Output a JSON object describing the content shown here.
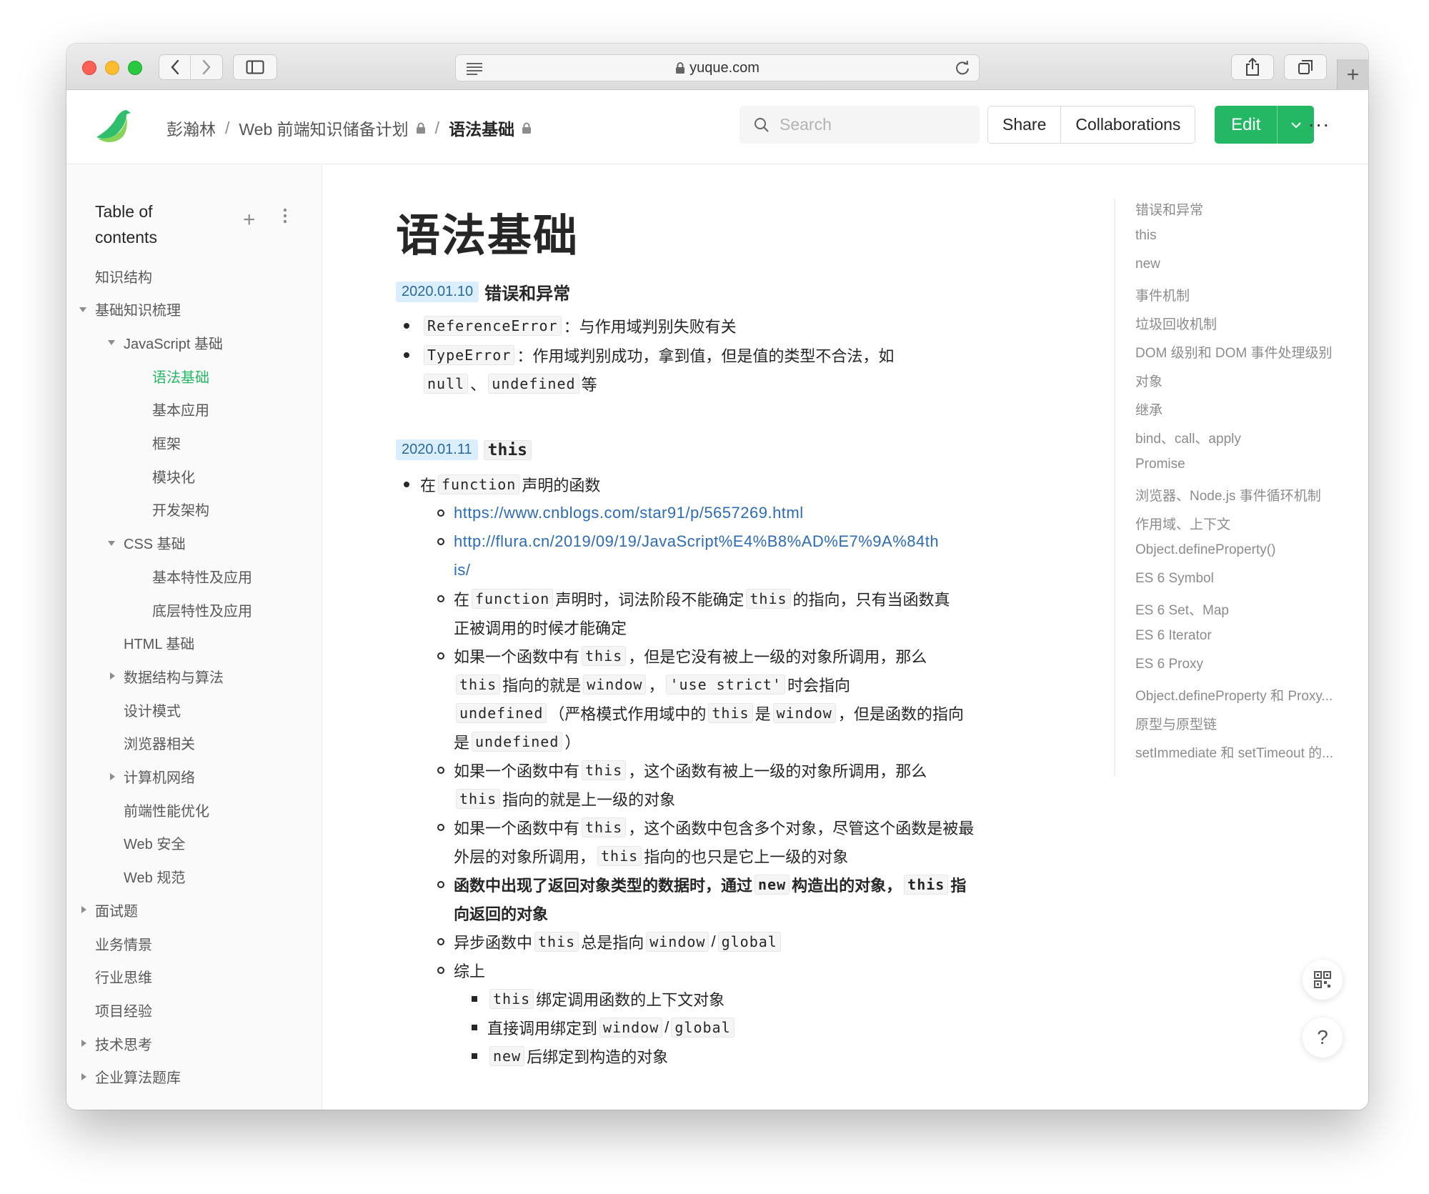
{
  "browser": {
    "address": "yuque.com"
  },
  "header": {
    "breadcrumb": [
      "彭瀚林",
      "Web 前端知识储备计划",
      "语法基础"
    ],
    "search_placeholder": "Search",
    "share": "Share",
    "collaborations": "Collaborations",
    "edit": "Edit",
    "more": "···"
  },
  "sidebar": {
    "title": "Table of contents",
    "add": "+",
    "items": [
      {
        "label": "知识结构",
        "level": 0,
        "caret": "none"
      },
      {
        "label": "基础知识梳理",
        "level": 0,
        "caret": "down"
      },
      {
        "label": "JavaScript 基础",
        "level": 1,
        "caret": "down"
      },
      {
        "label": "语法基础",
        "level": 2,
        "caret": "none",
        "active": true
      },
      {
        "label": "基本应用",
        "level": 2,
        "caret": "none"
      },
      {
        "label": "框架",
        "level": 2,
        "caret": "none"
      },
      {
        "label": "模块化",
        "level": 2,
        "caret": "none"
      },
      {
        "label": "开发架构",
        "level": 2,
        "caret": "none"
      },
      {
        "label": "CSS 基础",
        "level": 1,
        "caret": "down"
      },
      {
        "label": "基本特性及应用",
        "level": 2,
        "caret": "none"
      },
      {
        "label": "底层特性及应用",
        "level": 2,
        "caret": "none"
      },
      {
        "label": "HTML 基础",
        "level": 1,
        "caret": "none"
      },
      {
        "label": "数据结构与算法",
        "level": 1,
        "caret": "right"
      },
      {
        "label": "设计模式",
        "level": 1,
        "caret": "none"
      },
      {
        "label": "浏览器相关",
        "level": 1,
        "caret": "none"
      },
      {
        "label": "计算机网络",
        "level": 1,
        "caret": "right"
      },
      {
        "label": "前端性能优化",
        "level": 1,
        "caret": "none"
      },
      {
        "label": "Web 安全",
        "level": 1,
        "caret": "none"
      },
      {
        "label": "Web 规范",
        "level": 1,
        "caret": "none"
      },
      {
        "label": "面试题",
        "level": 0,
        "caret": "right"
      },
      {
        "label": "业务情景",
        "level": 0,
        "caret": "none"
      },
      {
        "label": "行业思维",
        "level": 0,
        "caret": "none"
      },
      {
        "label": "项目经验",
        "level": 0,
        "caret": "none"
      },
      {
        "label": "技术思考",
        "level": 0,
        "caret": "right"
      },
      {
        "label": "企业算法题库",
        "level": 0,
        "caret": "right"
      }
    ]
  },
  "doc": {
    "title": "语法基础",
    "section1": {
      "date": "2020.01.10",
      "heading": "错误和异常",
      "b1_code": "ReferenceError",
      "b1_text": "：与作用域判别失败有关",
      "b2_code": "TypeError",
      "b2_text": "：作用域判别成功，拿到值，但是值的类型不合法，如",
      "b2_code2": "null",
      "b2_sep": "、",
      "b2_code3": "undefined",
      "b2_tail": "等"
    },
    "section2": {
      "date": "2020.01.11",
      "heading": "this",
      "b1_pre": "在",
      "b1_code": "function",
      "b1_text": "声明的函数",
      "link1": "https://www.cnblogs.com/star91/p/5657269.html",
      "link2a": "http://flura.cn/2019/09/19/JavaScript%E4%B8%AD%E7%9A%84th",
      "link2b": "is/",
      "s3_pre": "在",
      "s3_code": "function",
      "s3_mid": "声明时，词法阶段不能确定",
      "s3_code2": "this",
      "s3_tail": "的指向，只有当函数真",
      "s3_line2": "正被调用的时候才能确定",
      "s4_pre": "如果一个函数中有",
      "s4_code": "this",
      "s4_tail": "，但是它没有被上一级的对象所调用，那么",
      "s4_l2_code": "this",
      "s4_l2_mid": "指向的就是",
      "s4_l2_code2": "window",
      "s4_l2_sep": "，",
      "s4_l2_code3": "'use strict'",
      "s4_l2_tail": "时会指向",
      "s4_l3_code": "undefined",
      "s4_l3_mid": "（严格模式作用域中的",
      "s4_l3_code2": "this",
      "s4_l3_mid2": "是",
      "s4_l3_code3": "window",
      "s4_l3_tail": "，但是函数的指向",
      "s4_l4_pre": "是",
      "s4_l4_code": "undefined",
      "s4_l4_tail": "）",
      "s5_pre": "如果一个函数中有",
      "s5_code": "this",
      "s5_tail": "，这个函数有被上一级的对象所调用，那么",
      "s5_l2_code": "this",
      "s5_l2_tail": "指向的就是上一级的对象",
      "s6_pre": "如果一个函数中有",
      "s6_code": "this",
      "s6_tail": "，这个函数中包含多个对象，尽管这个函数是被最",
      "s6_l2_pre": "外层的对象所调用，",
      "s6_l2_code": "this",
      "s6_l2_tail": "指向的也只是它上一级的对象",
      "s7_pre": "函数中出现了返回对象类型的数据时，通过",
      "s7_code": "new",
      "s7_mid": "构造出的对象，",
      "s7_code2": "this",
      "s7_tail": "指",
      "s7_l2": "向返回的对象",
      "s8_pre": "异步函数中",
      "s8_code": "this",
      "s8_mid": "总是指向",
      "s8_code2": "window",
      "s8_sep": "/",
      "s8_code3": "global",
      "s9": "综上",
      "t1_code": "this",
      "t1_tail": "绑定调用函数的上下文对象",
      "t2_pre": "直接调用绑定到",
      "t2_code": "window",
      "t2_sep": "/",
      "t2_code2": "global",
      "t3_code": "new",
      "t3_tail": "后绑定到构造的对象"
    }
  },
  "outline": [
    "错误和异常",
    "this",
    "new",
    "事件机制",
    "垃圾回收机制",
    "DOM 级别和 DOM 事件处理级别",
    "对象",
    "继承",
    "bind、call、apply",
    "Promise",
    "浏览器、Node.js 事件循环机制",
    "作用域、上下文",
    "Object.defineProperty()",
    "ES 6 Symbol",
    "ES 6 Set、Map",
    "ES 6 Iterator",
    "ES 6 Proxy",
    "Object.defineProperty 和 Proxy...",
    "原型与原型链",
    "setImmediate 和 setTimeout 的..."
  ],
  "float": {
    "help": "?"
  },
  "colors": {
    "brand": "#25b864",
    "link": "#2d6bb5",
    "date_tag_bg": "#dbeefd"
  }
}
